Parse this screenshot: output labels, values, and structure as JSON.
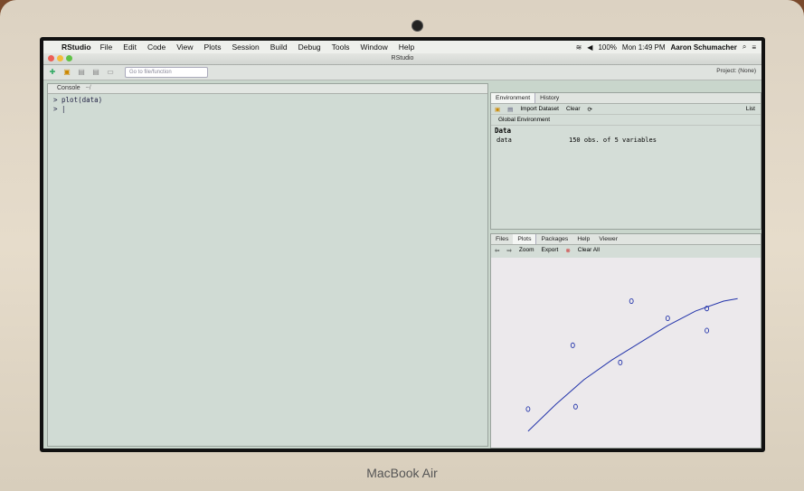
{
  "menubar": {
    "app": "RStudio",
    "items": [
      "File",
      "Edit",
      "Code",
      "View",
      "Plots",
      "Session",
      "Build",
      "Debug",
      "Tools",
      "Window",
      "Help"
    ],
    "battery": "100%",
    "clock": "Mon 1:49 PM",
    "user": "Aaron Schumacher"
  },
  "window": {
    "title": "RStudio"
  },
  "toolbar": {
    "goto_placeholder": "Go to file/function",
    "project": "Project: (None)"
  },
  "console": {
    "tab": "Console",
    "path": "~/",
    "lines": [
      "> plot(data)",
      "> |"
    ]
  },
  "environment": {
    "tabs": [
      "Environment",
      "History"
    ],
    "import_label": "Import Dataset",
    "clear_label": "Clear",
    "list_label": "List",
    "scope": "Global Environment",
    "section": "Data",
    "rows": [
      {
        "name": "data",
        "desc": "150 obs. of 5 variables"
      }
    ]
  },
  "plots_pane": {
    "tabs": [
      "Files",
      "Plots",
      "Packages",
      "Help",
      "Viewer"
    ],
    "zoom_label": "Zoom",
    "export_label": "Export",
    "clear_all_label": "Clear All"
  },
  "brand": "MacBook Air",
  "chart_data": {
    "type": "scatter",
    "title": "",
    "xlabel": "",
    "ylabel": "",
    "points": [
      {
        "x": 1.0,
        "y": 1.2
      },
      {
        "x": 2.6,
        "y": 3.8
      },
      {
        "x": 2.7,
        "y": 1.3
      },
      {
        "x": 4.3,
        "y": 3.1
      },
      {
        "x": 4.7,
        "y": 5.6
      },
      {
        "x": 6.0,
        "y": 4.9
      },
      {
        "x": 7.4,
        "y": 5.3
      },
      {
        "x": 7.4,
        "y": 4.4
      }
    ],
    "curve": [
      [
        1.0,
        0.3
      ],
      [
        2.0,
        1.4
      ],
      [
        3.0,
        2.4
      ],
      [
        4.0,
        3.2
      ],
      [
        5.0,
        3.9
      ],
      [
        6.0,
        4.6
      ],
      [
        7.0,
        5.2
      ],
      [
        8.0,
        5.6
      ],
      [
        8.5,
        5.7
      ]
    ],
    "xlim": [
      0,
      9
    ],
    "ylim": [
      0,
      7
    ]
  }
}
